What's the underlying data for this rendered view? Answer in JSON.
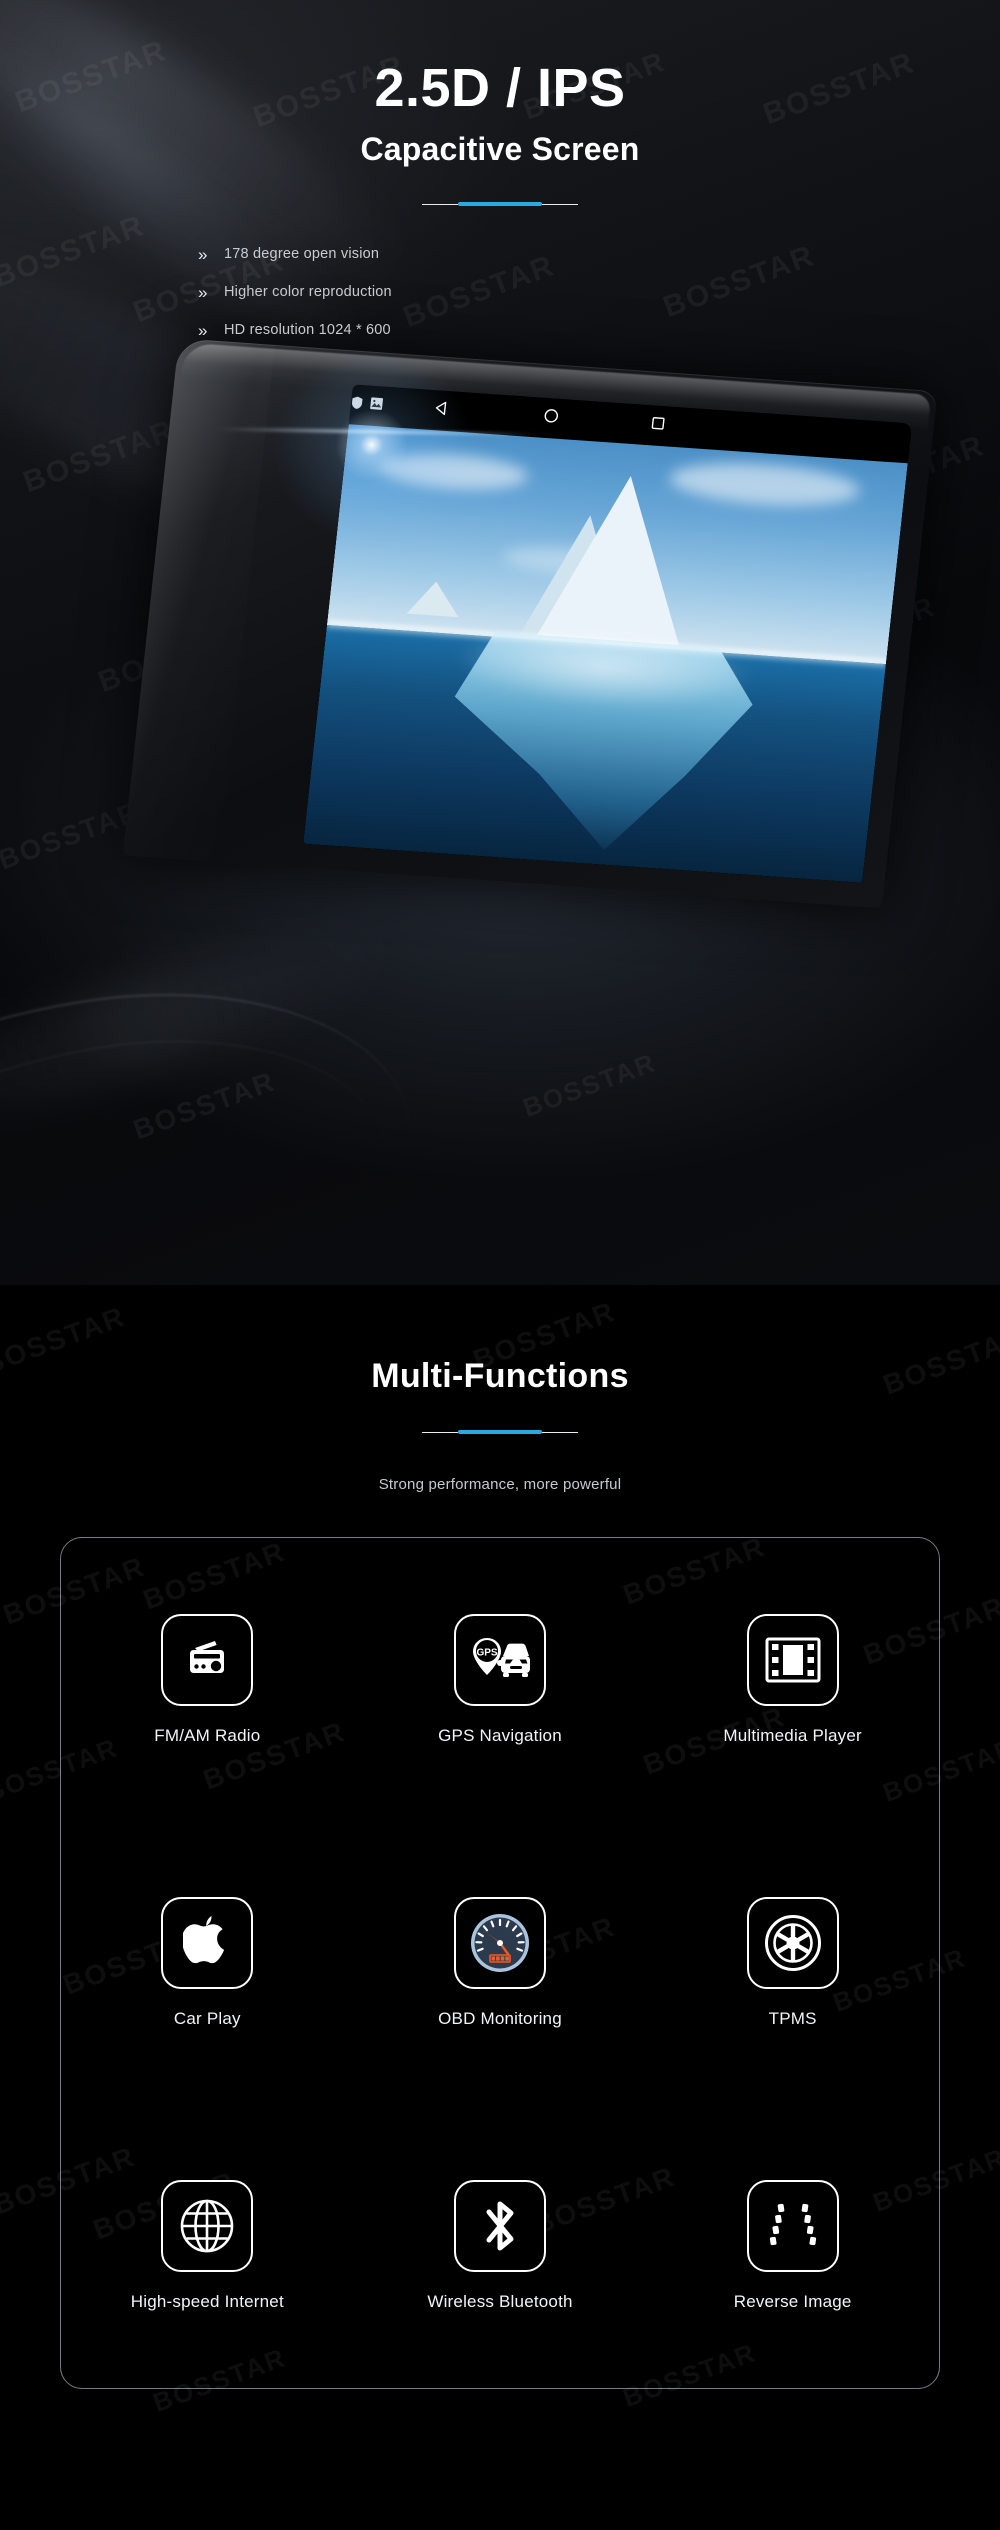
{
  "brand": {
    "watermark": "BOSSTAR"
  },
  "theme": {
    "accent": "#29ABE2",
    "background": "#000000",
    "text": "#FFFFFF",
    "muted": "#C8CCD2"
  },
  "hero": {
    "title": "2.5D / IPS",
    "subtitle": "Capacitive Screen",
    "bullet_marker": "»",
    "bullets": [
      "178 degree open vision",
      "Higher color reproduction",
      "HD resolution 1024 * 600"
    ],
    "device": {
      "navbar": {
        "back_icon": "triangle-back-icon",
        "home_icon": "circle-home-icon",
        "recents_icon": "square-recents-icon",
        "status_icons": [
          "shield-icon",
          "image-icon"
        ]
      },
      "wallpaper": "iceberg-photo"
    }
  },
  "functions": {
    "title": "Multi-Functions",
    "subtitle": "Strong performance, more powerful",
    "items": [
      {
        "label": "FM/AM Radio",
        "icon": "radio-icon"
      },
      {
        "label": "GPS Navigation",
        "icon": "gps-car-icon"
      },
      {
        "label": "Multimedia Player",
        "icon": "film-icon"
      },
      {
        "label": "Car Play",
        "icon": "apple-icon"
      },
      {
        "label": "OBD Monitoring",
        "icon": "gauge-icon"
      },
      {
        "label": "TPMS",
        "icon": "tire-icon"
      },
      {
        "label": "High-speed Internet",
        "icon": "globe-icon"
      },
      {
        "label": "Wireless Bluetooth",
        "icon": "bluetooth-icon"
      },
      {
        "label": "Reverse Image",
        "icon": "parking-lines-icon"
      }
    ]
  }
}
